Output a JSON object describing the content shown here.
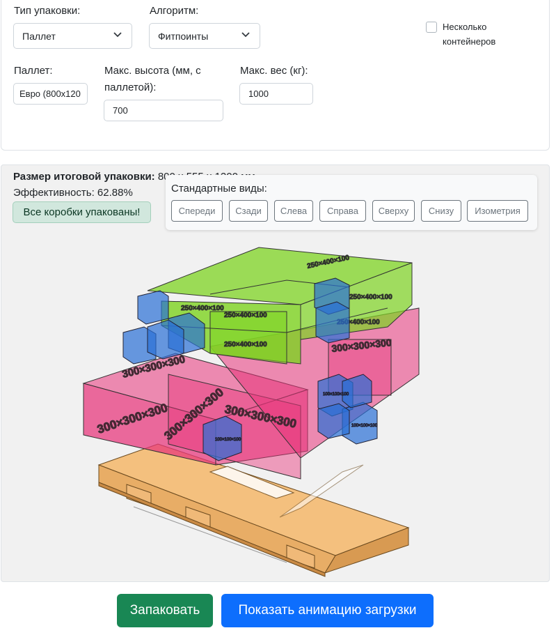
{
  "settings": {
    "packing_type_label": "Тип упаковки:",
    "packing_type_value": "Паллет",
    "algorithm_label": "Алгоритм:",
    "algorithm_value": "Фитпоинты",
    "multi_container_label": "Несколько контейнеров",
    "multi_container_checked": false,
    "pallet_label": "Паллет:",
    "pallet_value": "Евро (800x120",
    "max_height_label": "Макс. высота (мм, с паллетой):",
    "max_height_value": "700",
    "max_weight_label": "Макс. вес (кг):",
    "max_weight_value": "1000"
  },
  "result": {
    "size_label": "Размер итоговой упаковки:",
    "size_value": "800 x 555 x 1200 мм",
    "efficiency": "Эффективность: 62.88%",
    "status": "Все коробки упакованы!"
  },
  "views": {
    "title": "Стандартные виды:",
    "buttons": [
      "Спереди",
      "Сзади",
      "Слева",
      "Справа",
      "Сверху",
      "Снизу",
      "Изометрия"
    ]
  },
  "boxes": {
    "large_label": "300×300×300",
    "medium_label": "250×400×100",
    "small_label": "100×100×100"
  },
  "colors": {
    "pink": "#e8337a",
    "green": "#7ed321",
    "blue": "#2a6fd6",
    "pallet_wood": "#f7c98a",
    "primary": "#0d6efd",
    "success": "#198754"
  },
  "actions": {
    "pack": "Запаковать",
    "animate": "Показать анимацию загрузки"
  }
}
